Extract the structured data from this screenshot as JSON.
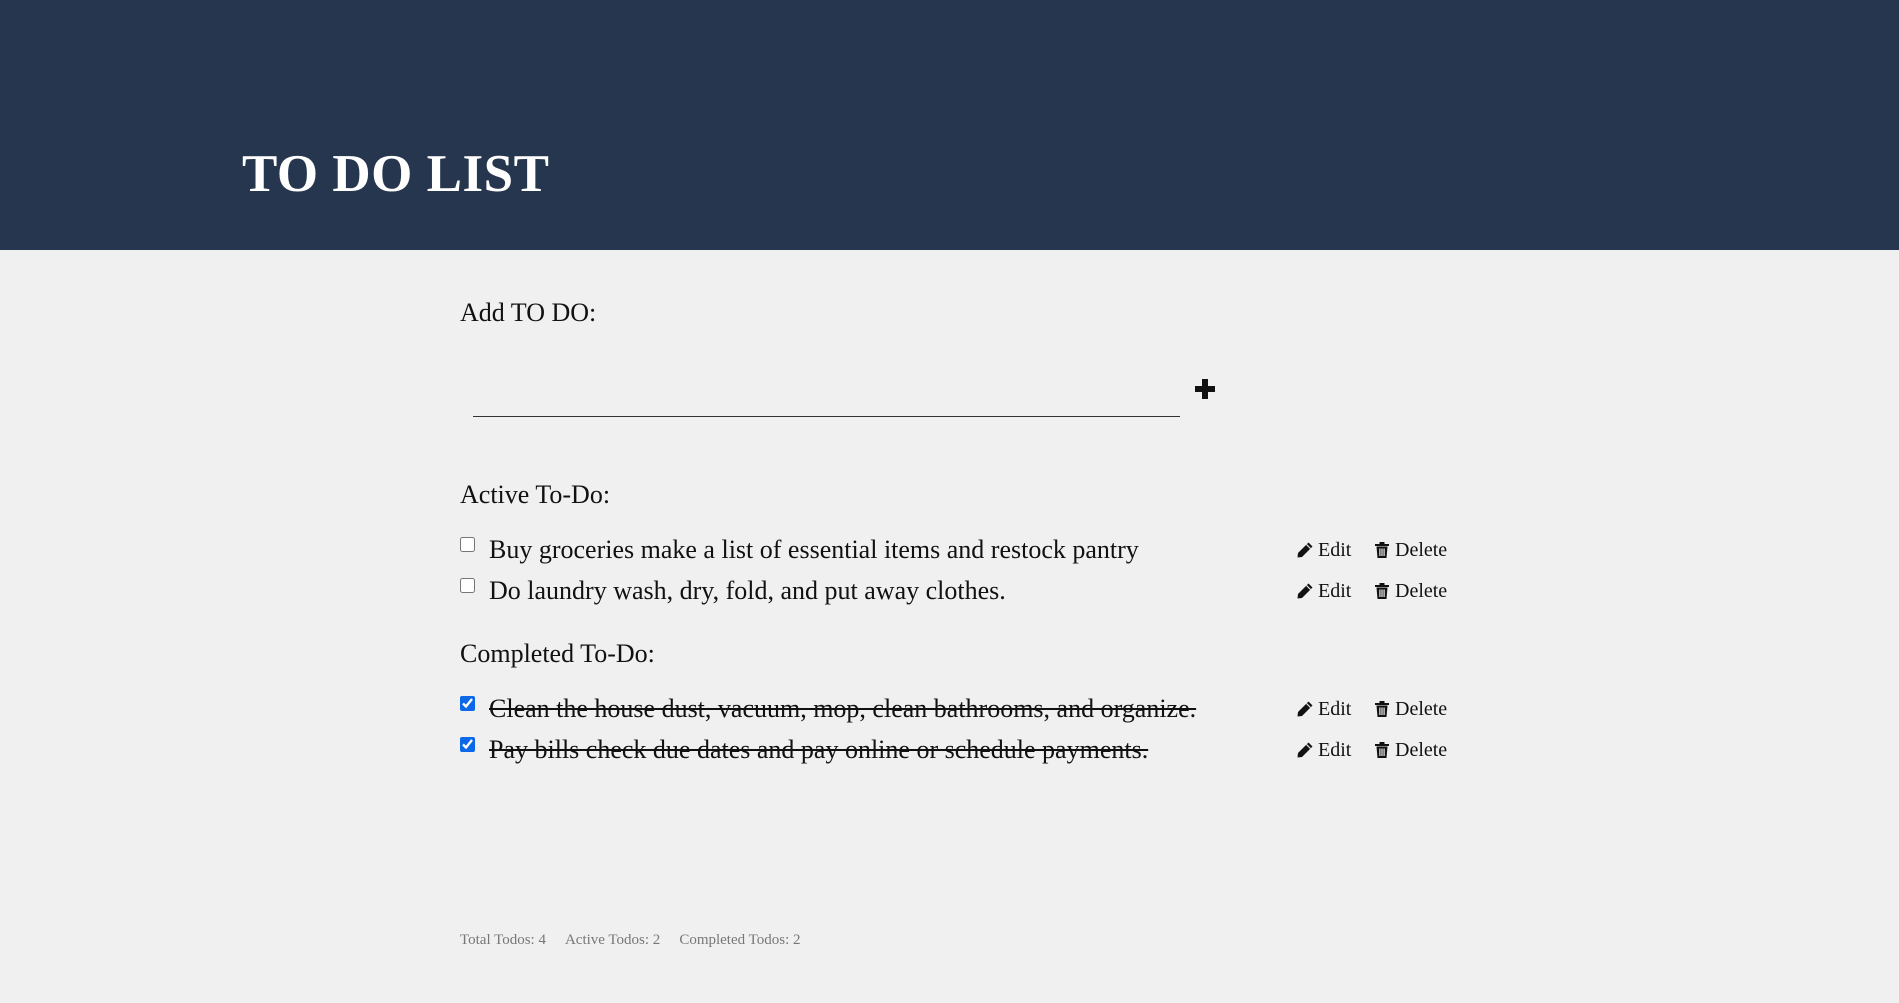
{
  "header": {
    "title": "TO DO LIST"
  },
  "add": {
    "label": "Add TO DO:",
    "input_value": "",
    "input_placeholder": "",
    "button_icon": "plus-icon"
  },
  "active": {
    "label": "Active To-Do:",
    "items": [
      {
        "text": "Buy groceries make a list of essential items and restock pantry",
        "checked": false
      },
      {
        "text": "Do laundry wash, dry, fold, and put away clothes.",
        "checked": false
      }
    ]
  },
  "completed": {
    "label": "Completed To-Do:",
    "items": [
      {
        "text": "Clean the house dust, vacuum, mop, clean bathrooms, and organize.",
        "checked": true
      },
      {
        "text": "Pay bills check due dates and pay online or schedule payments.",
        "checked": true
      }
    ]
  },
  "actions": {
    "edit_label": "Edit",
    "delete_label": "Delete",
    "edit_icon": "pencil-icon",
    "delete_icon": "trash-icon"
  },
  "stats": {
    "total": "Total Todos: 4",
    "active": "Active Todos: 2",
    "completed": "Completed Todos: 2"
  },
  "colors": {
    "header_bg": "#27364f",
    "page_bg": "#f0f0f0",
    "checkbox_accent": "#0b68e8"
  }
}
